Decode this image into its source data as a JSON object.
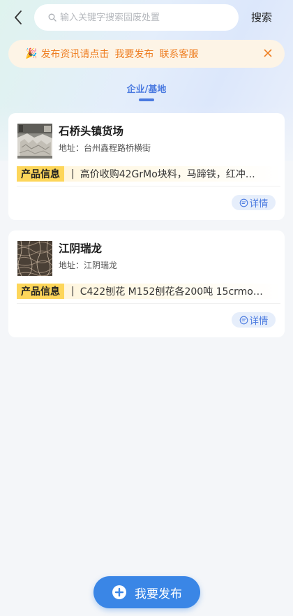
{
  "topbar": {
    "search_placeholder": "输入关键字搜索固废处置",
    "search_button": "搜索"
  },
  "notice": {
    "text": "发布资讯请点击",
    "publish_link": "我要发布",
    "contact_link": "联系客服"
  },
  "tabs": [
    {
      "label": "企业/基地",
      "active": true
    }
  ],
  "cards": [
    {
      "title": "石桥头镇货场",
      "address": "地址：台州鑫程路桥横街",
      "info_label": "产品信息",
      "info_sep": "|",
      "info_text": "高价收购42GrMo块料，马蹄铁，红冲…",
      "detail_label": "详情"
    },
    {
      "title": "江阴瑞龙",
      "address": "地址：江阴瑞龙",
      "info_label": "产品信息",
      "info_sep": "|",
      "info_text": "C422刨花 M152刨花各200吨 15crmo…",
      "detail_label": "详情"
    }
  ],
  "fab": {
    "label": "我要发布"
  },
  "colors": {
    "accent": "#4a7ae0",
    "notice_text": "#ee7d20",
    "fab": "#3a86e6",
    "label_yellow": "#fdd65a"
  }
}
